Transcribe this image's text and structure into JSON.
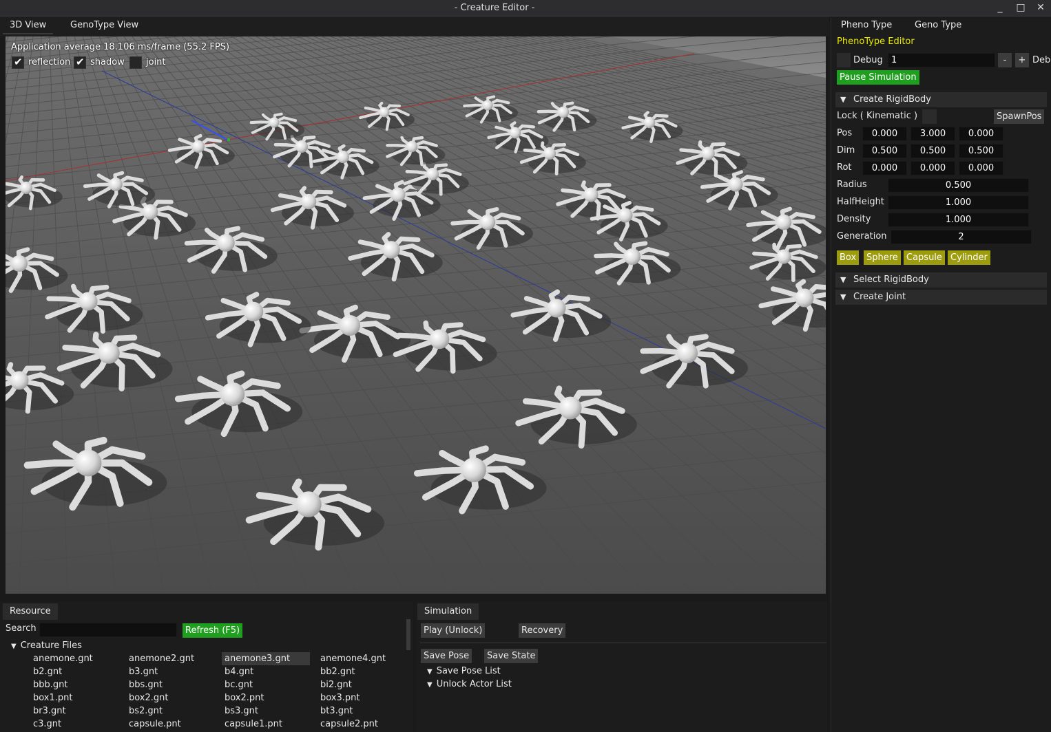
{
  "window": {
    "title": "- Creature Editor -",
    "controls": [
      "_",
      "□",
      "✕"
    ]
  },
  "main_tabs": [
    "3D View",
    "GenoType View"
  ],
  "viewport": {
    "fps_text": "Application average 18.106 ms/frame (55.2 FPS)",
    "options": [
      {
        "label": "reflection",
        "checked": true
      },
      {
        "label": "shadow",
        "checked": true
      },
      {
        "label": "joint",
        "checked": false
      }
    ]
  },
  "right_panel": {
    "tabs": [
      "Pheno Type",
      "Geno Type"
    ],
    "editor_title": "PhenoType Editor",
    "debug": {
      "label": "Debug",
      "value": "1",
      "minus": "-",
      "plus": "+",
      "extra": "Deb"
    },
    "pause_button": "Pause Simulation",
    "create_rigidbody": {
      "header": "Create RigidBody",
      "lock_label": "Lock ( Kinematic )",
      "spawnpos_button": "SpawnPos",
      "pos": {
        "label": "Pos",
        "values": [
          "0.000",
          "3.000",
          "0.000"
        ]
      },
      "dim": {
        "label": "Dim",
        "values": [
          "0.500",
          "0.500",
          "0.500"
        ]
      },
      "rot": {
        "label": "Rot",
        "values": [
          "0.000",
          "0.000",
          "0.000"
        ]
      },
      "radius": {
        "label": "Radius",
        "value": "0.500"
      },
      "halfheight": {
        "label": "HalfHeight",
        "value": "1.000"
      },
      "density": {
        "label": "Density",
        "value": "1.000"
      },
      "generation": {
        "label": "Generation",
        "value": "2"
      },
      "shape_buttons": [
        "Box",
        "Sphere",
        "Capsule",
        "Cylinder"
      ]
    },
    "select_rigidbody": "Select RigidBody",
    "create_joint": "Create Joint"
  },
  "resource": {
    "tab": "Resource",
    "search_label": "Search",
    "search_value": "",
    "refresh_button": "Refresh (F5)",
    "folder": "Creature Files",
    "files": [
      [
        "anemone.gnt",
        "anemone2.gnt",
        "anemone3.gnt",
        "anemone4.gnt"
      ],
      [
        "b2.gnt",
        "b3.gnt",
        "b4.gnt",
        "bb2.gnt"
      ],
      [
        "bbb.gnt",
        "bbs.gnt",
        "bc.gnt",
        "bi2.gnt"
      ],
      [
        "box1.pnt",
        "box2.gnt",
        "box2.pnt",
        "box3.pnt"
      ],
      [
        "br3.gnt",
        "bs2.gnt",
        "bs3.gnt",
        "bt3.gnt"
      ],
      [
        "c3.gnt",
        "capsule.pnt",
        "capsule1.pnt",
        "capsule2.pnt"
      ]
    ],
    "selected_file": "anemone3.gnt"
  },
  "simulation": {
    "tab": "Simulation",
    "play_button": "Play (Unlock)",
    "recovery_button": "Recovery",
    "save_pose_button": "Save Pose",
    "save_state_button": "Save State",
    "lists": [
      "Save Pose List",
      "Unlock Actor List"
    ]
  },
  "colors": {
    "accent_green": "#1f9e1f",
    "accent_olive": "#9c9c0e",
    "editor_title": "#e8e800",
    "background": "#1c1c1c"
  }
}
